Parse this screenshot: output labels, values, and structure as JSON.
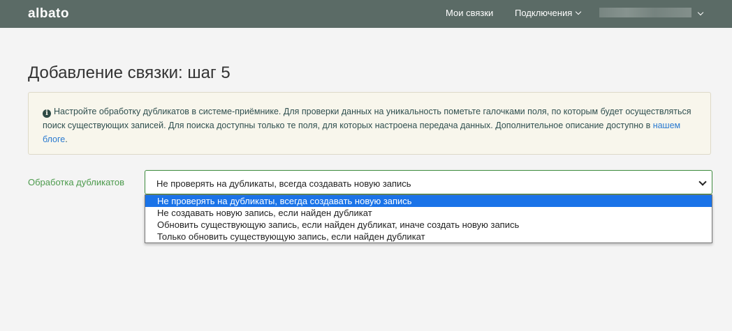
{
  "header": {
    "logo": "albato",
    "nav": [
      {
        "label": "Мои связки"
      },
      {
        "label": "Подключения"
      }
    ]
  },
  "page": {
    "title": "Добавление связки: шаг 5"
  },
  "alert": {
    "icon": "info-circle-icon",
    "text": "Настройте обработку дубликатов в системе-приёмнике. Для проверки данных на уникальность пометьте галочками поля, по которым будет осуществляться поиск существующих записей. Для поиска доступны только те поля, для которых настроена передача данных. Дополнительное описание доступно в ",
    "link_text": "нашем блоге",
    "after_link": "."
  },
  "duplicates": {
    "label": "Обработка дубликатов",
    "selected": "Не проверять на дубликаты, всегда создавать новую запись",
    "options": [
      "Не проверять на дубликаты, всегда создавать новую запись",
      "Не создавать новую запись, если найден дубликат",
      "Обновить существующую запись, если найден дубликат, иначе создать новую запись",
      "Только обновить существующую запись, если найден дубликат"
    ]
  },
  "colors": {
    "header_bg": "#5b6b66",
    "accent_green": "#4c9a4c",
    "selected_option": "#1a73e8",
    "link": "#2a7ad0"
  }
}
